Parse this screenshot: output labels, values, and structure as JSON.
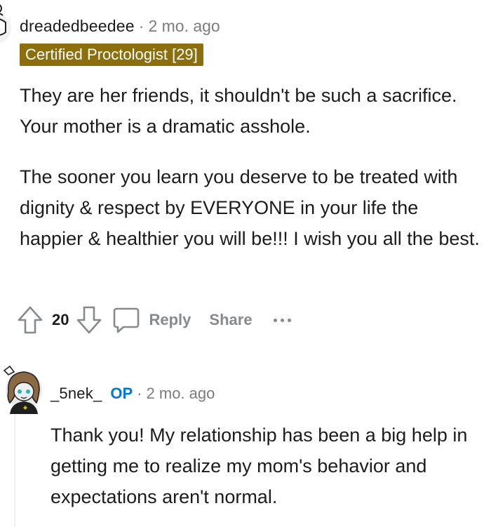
{
  "comment1": {
    "author": "dreadedbeedee",
    "separator": "·",
    "time": "2 mo. ago",
    "flair": "Certified Proctologist [29]",
    "paragraphs": [
      "They are her friends, it shouldn't be such a sacrifice. Your mother is a dramatic asshole.",
      "The sooner you learn you deserve to be treated with dignity & respect by EVERYONE in your life the happier & healthier you will be!!! I wish you all the best."
    ],
    "actions": {
      "votes": "20",
      "reply_label": "Reply",
      "share_label": "Share"
    }
  },
  "comment2": {
    "author": "_5nek_",
    "op_label": "OP",
    "separator": "·",
    "time": "2 mo. ago",
    "body": "Thank you! My relationship has been a big help in getting me to realize my mom's behavior and expectations aren't normal."
  },
  "colors": {
    "flair_bg": "#8c6e0c",
    "op_blue": "#0079d3",
    "meta_gray": "#7c7c7c",
    "action_gray": "#878a8c"
  },
  "icons": [
    "upvote-icon",
    "downvote-icon",
    "comment-bubble-icon",
    "more-options-icon"
  ]
}
